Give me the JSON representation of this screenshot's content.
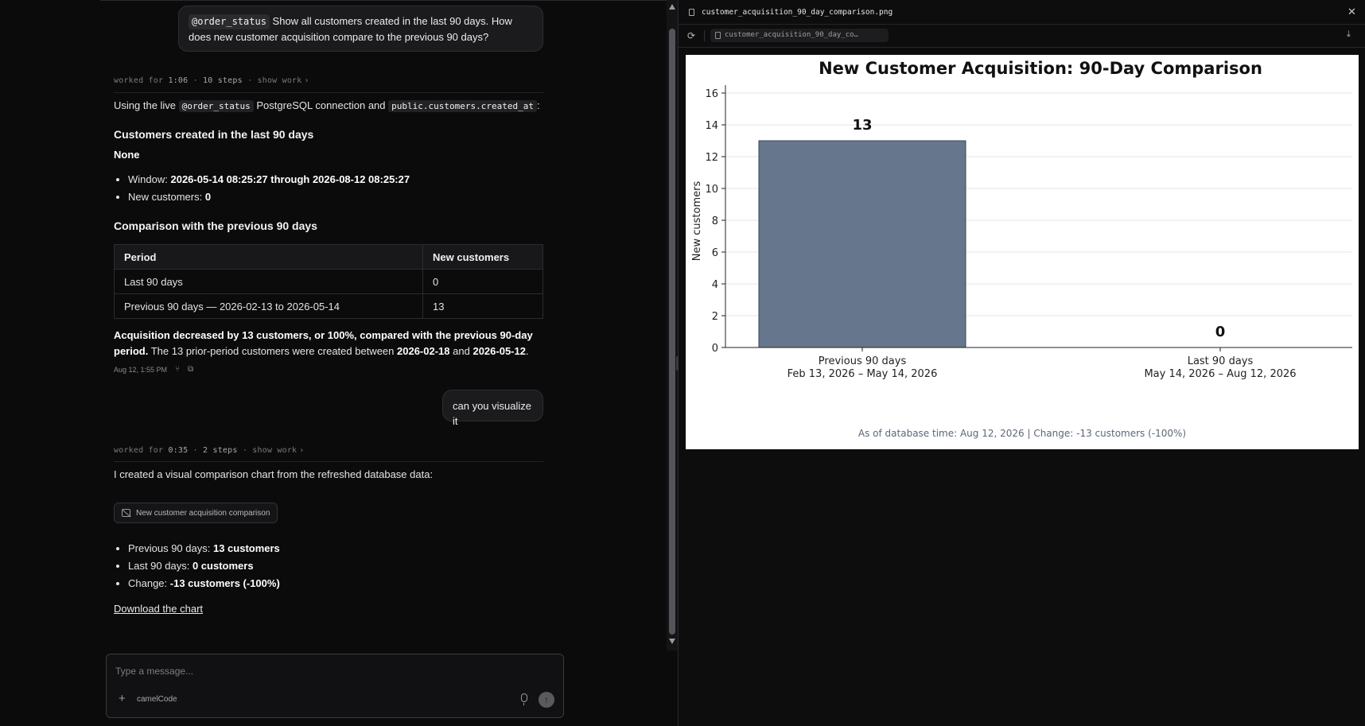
{
  "chat": {
    "user_msg_1": {
      "mention": "@order_status",
      "text": "Show all customers created in the last 90 days. How does new customer acquisition compare to the previous 90 days?"
    },
    "worked_1": {
      "prefix": "worked for",
      "time": "1:06",
      "sep1": "·",
      "steps": "10 steps",
      "sep2": "·",
      "show": "show work"
    },
    "intro": {
      "pre": "Using the live",
      "mention": "@order_status",
      "mid": "PostgreSQL connection and",
      "code": "public.customers.created_at",
      "post": ":"
    },
    "section1_title": "Customers created in the last 90 days",
    "none_label": "None",
    "bullets1": [
      {
        "label": "Window:",
        "value": "2026-05-14 08:25:27 through 2026-08-12 08:25:27"
      },
      {
        "label": "New customers:",
        "value": "0"
      }
    ],
    "section2_title": "Comparison with the previous 90 days",
    "table": {
      "headers": [
        "Period",
        "New customers"
      ],
      "rows": [
        [
          "Last 90 days",
          "0"
        ],
        [
          "Previous 90 days — 2026-02-13 to 2026-05-14",
          "13"
        ]
      ]
    },
    "summary": {
      "bold": "Acquisition decreased by 13 customers, or 100%, compared with the previous 90-day period.",
      "rest_pre": "The 13 prior-period customers were created between",
      "date1": "2026-02-18",
      "and": "and",
      "date2": "2026-05-12",
      "end": "."
    },
    "meta_time": "Aug 12, 1:55 PM",
    "user_msg_2": "can you visualize it",
    "worked_2": {
      "prefix": "worked for",
      "time": "0:35",
      "sep1": "·",
      "steps": "2 steps",
      "sep2": "·",
      "show": "show work"
    },
    "chart_intro": "I created a visual comparison chart from the refreshed database data:",
    "attachment_label": "New customer acquisition comparison",
    "bullets2": [
      {
        "label": "Previous 90 days:",
        "value": "13 customers"
      },
      {
        "label": "Last 90 days:",
        "value": "0 customers"
      },
      {
        "label": "Change:",
        "value": "-13 customers (-100%)"
      }
    ],
    "download_link": "Download the chart"
  },
  "composer": {
    "placeholder": "Type a message...",
    "model": "camelCode"
  },
  "viewer": {
    "filename": "customer_acquisition_90_day_comparison.png",
    "url": "customer_acquisition_90_day_co…"
  },
  "colors": {
    "bar": "#66768c",
    "bg": "#0b0b0c",
    "panel": "#1b1b1d"
  },
  "chart_data": {
    "type": "bar",
    "title": "New Customer Acquisition: 90-Day Comparison",
    "ylabel": "New customers",
    "xlabel": "",
    "categories": [
      [
        "Previous 90 days",
        "Feb 13, 2026 – May 14, 2026"
      ],
      [
        "Last 90 days",
        "May 14, 2026 – Aug 12, 2026"
      ]
    ],
    "values": [
      13,
      0
    ],
    "data_labels": [
      "13",
      "0"
    ],
    "ylim": [
      0,
      16.5
    ],
    "yticks": [
      0,
      2,
      4,
      6,
      8,
      10,
      12,
      14,
      16
    ],
    "grid": "y",
    "footer": "As of database time: Aug 12, 2026 | Change: -13 customers (-100%)"
  }
}
